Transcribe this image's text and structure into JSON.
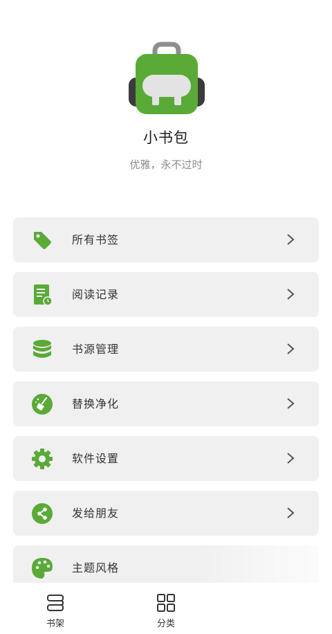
{
  "app": {
    "name": "小书包",
    "slogan": "优雅，永不过时"
  },
  "colors": {
    "accent": "#5aaa37",
    "card_bg": "#f0f0f0"
  },
  "menu": [
    {
      "label": "所有书签",
      "icon": "bookmark-tag-icon"
    },
    {
      "label": "阅读记录",
      "icon": "reading-record-icon"
    },
    {
      "label": "书源管理",
      "icon": "database-icon"
    },
    {
      "label": "替换净化",
      "icon": "broom-clean-icon"
    },
    {
      "label": "软件设置",
      "icon": "gear-icon"
    },
    {
      "label": "发给朋友",
      "icon": "share-icon"
    },
    {
      "label": "主题风格",
      "icon": "palette-icon"
    }
  ],
  "nav": {
    "bookshelf": "书架",
    "category": "分类"
  }
}
